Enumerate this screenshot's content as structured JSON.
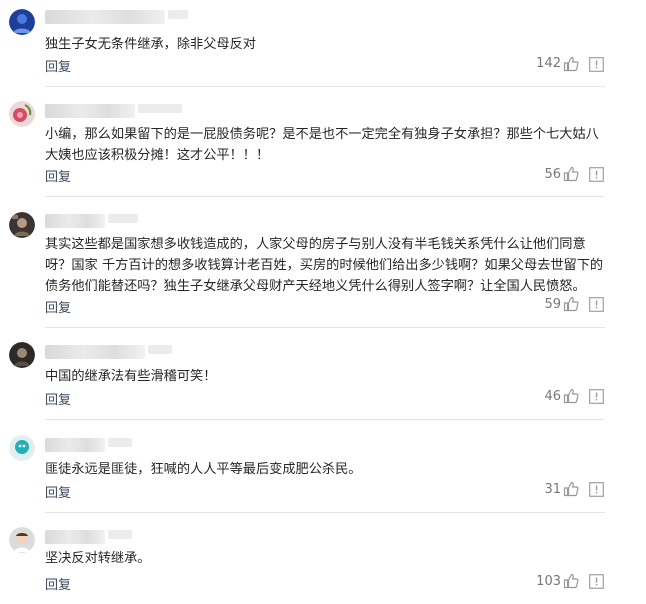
{
  "comments": [
    {
      "text": "独生子女无条件继承，除非父母反对",
      "reply_label": "回复",
      "likes": "142",
      "avatar_icon": "blue-figure-avatar"
    },
    {
      "text": "小编，那么如果留下的是一屁股债务呢？是不是也不一定完全有独身子女承担？那些个七大姑八大姨也应该积极分摊！这才公平！！！",
      "reply_label": "回复",
      "likes": "56",
      "avatar_icon": "pink-flower-avatar"
    },
    {
      "text": "其实这些都是国家想多收钱造成的，人家父母的房子与别人没有半毛钱关系凭什么让他们同意呀？国家 千方百计的想多收钱算计老百姓，买房的时候他们给出多少钱啊？如果父母去世留下的债务他们能替还吗？独生子女继承父母财产天经地义凭什么得别人签字啊？让全国人民愤怒。",
      "reply_label": "回复",
      "likes": "59",
      "avatar_icon": "dark-photo-avatar"
    },
    {
      "text": "中国的继承法有些滑稽可笑！",
      "reply_label": "回复",
      "likes": "46",
      "avatar_icon": "dark-photo-avatar"
    },
    {
      "text": "匪徒永远是匪徒，狂喊的人人平等最后变成肥公杀民。",
      "reply_label": "回复",
      "likes": "31",
      "avatar_icon": "teal-default-avatar"
    },
    {
      "text": "坚决反对转继承。",
      "reply_label": "回复",
      "likes": "103",
      "avatar_icon": "child-photo-avatar"
    }
  ],
  "icons": {
    "like": "thumbs-up-icon",
    "report": "report-icon"
  },
  "colors": {
    "reply": "#3b4a5c",
    "count": "#777777",
    "divider": "#e6e6e6"
  }
}
